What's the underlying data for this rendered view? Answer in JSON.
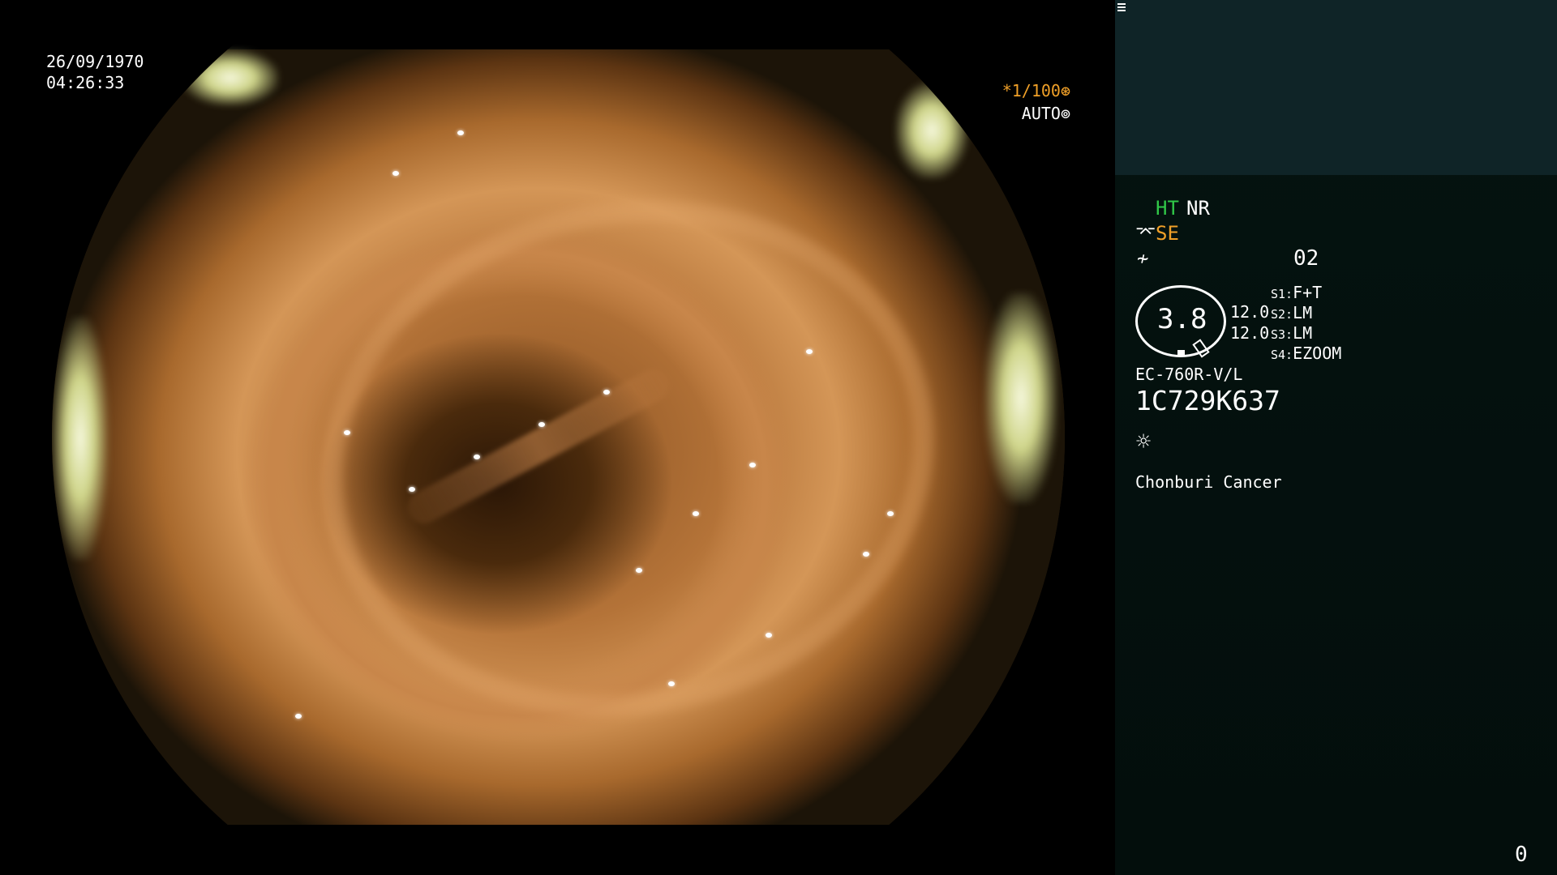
{
  "overlay": {
    "date": "26/09/1970",
    "time": "04:26:33",
    "shutter": "*1/100",
    "shutter_icon": "shutter-icon",
    "iris_mode": "AUTO",
    "iris_icon": "iris-icon"
  },
  "panel": {
    "structure_enhance": "HT",
    "noise_reduction": "NR",
    "se_icon": "scope-enhance-icon",
    "se_label": "SE",
    "enhance_icon": "color-enhance-icon",
    "memory_icon": "memory-card-icon",
    "memory_value": "02",
    "zoom": "3.8",
    "value_1": "12.0",
    "value_2": "12.0",
    "switches": [
      {
        "key": "S1:",
        "value": "F+T"
      },
      {
        "key": "S2:",
        "value": "LM"
      },
      {
        "key": "S3:",
        "value": "LM"
      },
      {
        "key": "S4:",
        "value": "EZOOM"
      }
    ],
    "scope_model": "EC-760R-V/L",
    "serial": "1C729K637",
    "light_icon": "light-source-icon",
    "institution": "Chonburi Cancer",
    "frame_counter": "0"
  },
  "colors": {
    "ht": "#30c848",
    "se": "#f0a028",
    "panel_top": "#0f2427",
    "panel_bg": "#051310"
  }
}
